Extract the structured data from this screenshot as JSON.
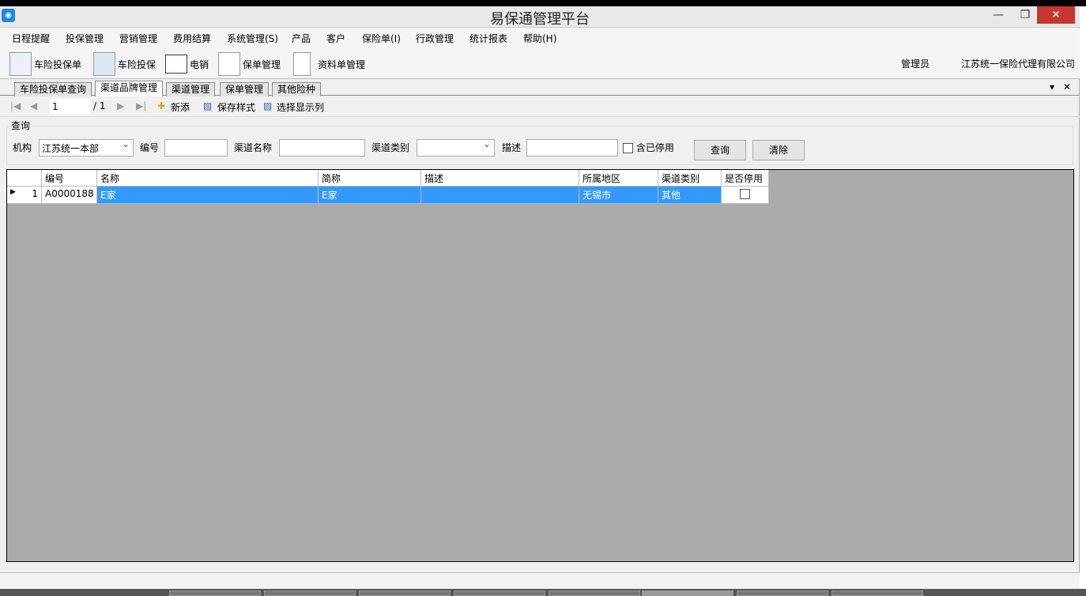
{
  "window": {
    "title": "易保通管理平台",
    "minimize": "—",
    "maximize": "❐",
    "close": "✕"
  },
  "menu": [
    "日程提醒",
    "投保管理",
    "营销管理",
    "费用结算",
    "系统管理(S)",
    "产品",
    "客户",
    "保险单(I)",
    "行政管理",
    "统计报表",
    "帮助(H)"
  ],
  "toolbar": {
    "items": [
      "车险投保单",
      "车险投保",
      "电销",
      "保单管理",
      "资料单管理"
    ],
    "user_role": "管理员",
    "company": "江苏统一保险代理有限公司"
  },
  "tabs": [
    "车险投保单查询",
    "渠道品牌管理",
    "渠道管理",
    "保单管理",
    "其他险种"
  ],
  "tab_controls": {
    "dropdown": "▾",
    "close": "✕"
  },
  "nav": {
    "page": "1",
    "total": "/ 1",
    "add": "新添",
    "save_style": "保存样式",
    "choose_columns": "选择显示列"
  },
  "query": {
    "legend": "查询",
    "org_label": "机构",
    "org_value": "江苏统一本部",
    "code_label": "编号",
    "code_value": "",
    "name_label": "渠道名称",
    "name_value": "",
    "type_label": "渠道类别",
    "type_value": "",
    "desc_label": "描述",
    "desc_value": "",
    "include_disabled": "含已停用",
    "search_btn": "查询",
    "clear_btn": "清除"
  },
  "grid": {
    "columns": [
      "编号",
      "名称",
      "简称",
      "描述",
      "所属地区",
      "渠道类别",
      "是否停用"
    ],
    "rows": [
      {
        "index": "1",
        "cells": [
          "A0000188",
          "E家",
          "E家",
          "",
          "无锡市",
          "其他",
          ""
        ],
        "disabled": false
      }
    ]
  }
}
